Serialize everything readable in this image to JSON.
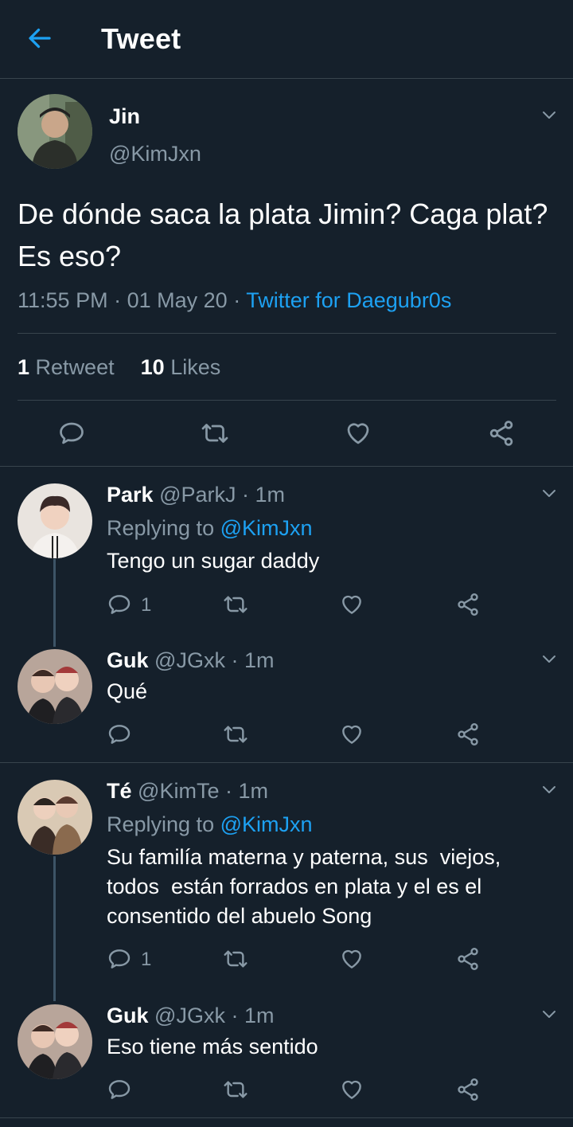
{
  "header": {
    "title": "Tweet"
  },
  "main_tweet": {
    "name": "Jin",
    "handle": "@KimJxn",
    "text": "De dónde saca la plata Jimin? Caga plat? Es eso?",
    "time": "11:55 PM",
    "date": "01 May 20",
    "sep": "·",
    "source": "Twitter for Daegubr0s",
    "retweets_count": "1",
    "retweets_label": "Retweet",
    "likes_count": "10",
    "likes_label": "Likes"
  },
  "replies": [
    {
      "name": "Park",
      "handle": "@ParkJ",
      "time": "· 1m",
      "replying_label": "Replying to",
      "replying_to": "@KimJxn",
      "text": "Tengo un sugar daddy",
      "reply_count": "1"
    },
    {
      "name": "Guk",
      "handle": "@JGxk",
      "time": "· 1m",
      "text": "Qué"
    },
    {
      "name": "Té",
      "handle": "@KimTe",
      "time": "· 1m",
      "replying_label": "Replying to",
      "replying_to": "@KimJxn",
      "text_lines": [
        "Su familía materna y paterna, sus  viejos,",
        "todos  están forrados en plata y el es el",
        "consentido del abuelo Song"
      ],
      "reply_count": "1"
    },
    {
      "name": "Guk",
      "handle": "@JGxk",
      "time": "· 1m",
      "text": "Eso tiene más sentido"
    }
  ],
  "colors": {
    "background": "#15202b",
    "accent": "#1da1f2",
    "muted": "#8899a6",
    "divider": "#38444d"
  },
  "icons": [
    "back-arrow-icon",
    "chevron-down-icon",
    "reply-icon",
    "retweet-icon",
    "like-icon",
    "share-icon"
  ]
}
